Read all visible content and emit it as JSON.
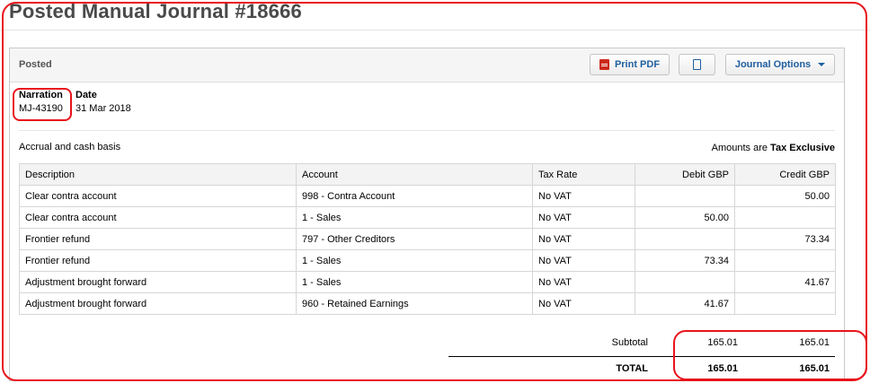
{
  "page": {
    "title": "Posted Manual Journal #18666"
  },
  "panel": {
    "status": "Posted",
    "buttons": {
      "print_pdf": "Print PDF",
      "journal_options": "Journal Options"
    },
    "icons": {
      "pdf": "pdf-icon",
      "copy": "copy-icon",
      "dropdown": "caret-down-icon"
    }
  },
  "meta": {
    "narration_label": "Narration",
    "narration_value": "MJ-43190",
    "date_label": "Date",
    "date_value": "31 Mar 2018"
  },
  "basis": "Accrual and cash basis",
  "amounts": {
    "prefix": "Amounts are",
    "value": "Tax Exclusive"
  },
  "table": {
    "headers": [
      "Description",
      "Account",
      "Tax Rate",
      "Debit GBP",
      "Credit GBP"
    ],
    "rows": [
      [
        "Clear contra account",
        "998 - Contra Account",
        "No VAT",
        "",
        "50.00"
      ],
      [
        "Clear contra account",
        "1 - Sales",
        "No VAT",
        "50.00",
        ""
      ],
      [
        "Frontier refund",
        "797 - Other Creditors",
        "No VAT",
        "",
        "73.34"
      ],
      [
        "Frontier refund",
        "1 - Sales",
        "No VAT",
        "73.34",
        ""
      ],
      [
        "Adjustment brought forward",
        "1 - Sales",
        "No VAT",
        "",
        "41.67"
      ],
      [
        "Adjustment brought forward",
        "960 - Retained Earnings",
        "No VAT",
        "41.67",
        ""
      ]
    ]
  },
  "totals": {
    "subtotal_label": "Subtotal",
    "subtotal_debit": "165.01",
    "subtotal_credit": "165.01",
    "total_label": "TOTAL",
    "total_debit": "165.01",
    "total_credit": "165.01"
  },
  "colors": {
    "annotation": "#e8141c",
    "link": "#1f5e9e"
  }
}
